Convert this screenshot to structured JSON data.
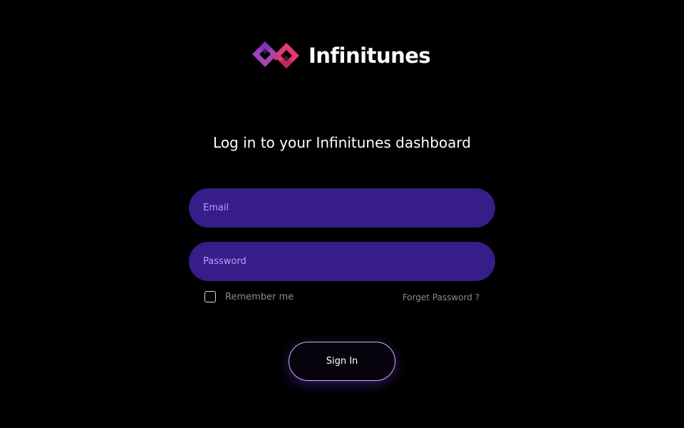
{
  "brand": {
    "name": "Infinitunes",
    "logo_icon": "infinity-logo-icon",
    "colors": {
      "purple": "#7b2fbe",
      "magenta": "#c2358f",
      "pink": "#e8356b"
    }
  },
  "login": {
    "heading": "Log in to your Infinitunes dashboard",
    "email": {
      "placeholder": "Email",
      "value": ""
    },
    "password": {
      "placeholder": "Password",
      "value": ""
    },
    "remember_me": {
      "label": "Remember me",
      "checked": false
    },
    "forgot_password_label": "Forget Password ?",
    "sign_in_label": "Sign In"
  },
  "theme": {
    "background": "#000000",
    "field_background": "#371d88",
    "placeholder_color": "#b79bff",
    "muted_text": "#8a8a98",
    "button_border": "#c9b3f0"
  }
}
